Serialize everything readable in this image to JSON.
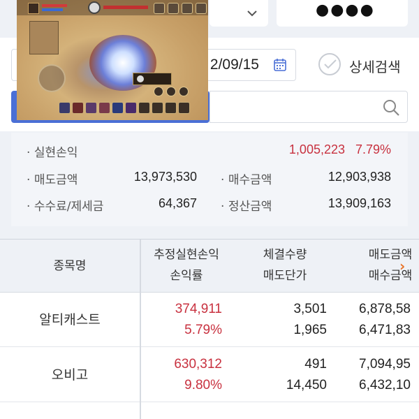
{
  "header": {
    "password_mask": "●●●●"
  },
  "search": {
    "end_date": "2/09/15",
    "detail_search_label": "상세검색",
    "stock_placeholder": ""
  },
  "summary": {
    "realized_pl_label": "실현손익",
    "realized_pl_value": "1,005,223",
    "realized_pl_rate": "7.79%",
    "sell_amount_label": "매도금액",
    "sell_amount_value": "13,973,530",
    "buy_amount_label": "매수금액",
    "buy_amount_value": "12,903,938",
    "fee_tax_label": "수수료/제세금",
    "fee_tax_value": "64,367",
    "settlement_label": "정산금액",
    "settlement_value": "13,909,163"
  },
  "table": {
    "headers": {
      "name": "종목명",
      "est_pl": "추정실현손익",
      "pl_rate": "손익률",
      "exec_qty": "체결수량",
      "sell_price": "매도단가",
      "sell_amount": "매도금액",
      "buy_amount": "매수금액"
    },
    "rows": [
      {
        "name": "알티캐스트",
        "est_pl": "374,911",
        "pl_rate": "5.79%",
        "exec_qty": "3,501",
        "sell_price": "1,965",
        "sell_amount": "6,878,58",
        "buy_amount": "6,471,83"
      },
      {
        "name": "오비고",
        "est_pl": "630,312",
        "pl_rate": "9.80%",
        "exec_qty": "491",
        "sell_price": "14,450",
        "sell_amount": "7,094,95",
        "buy_amount": "6,432,10"
      }
    ]
  },
  "colors": {
    "loss_profit_red": "#c8313f",
    "tab_blue": "#4a6fd6",
    "scroll_arrow": "#e8742a"
  },
  "icons": {
    "dropdown": "chevron-down-icon",
    "calendar": "calendar-icon",
    "check": "check-icon",
    "search": "search-icon",
    "scroll": "chevron-right-icon"
  }
}
